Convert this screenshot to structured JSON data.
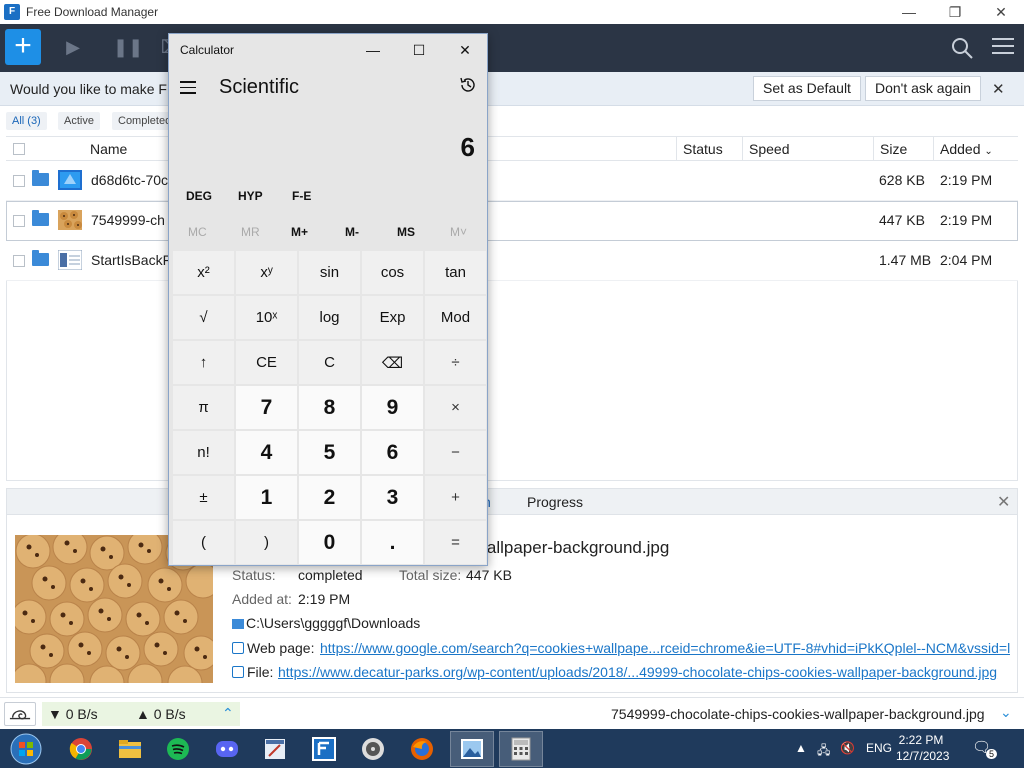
{
  "window": {
    "title": "Free Download Manager",
    "app_icon": "fdm-logo-icon",
    "controls": [
      "minimize",
      "restore",
      "close"
    ]
  },
  "toolbar": {
    "add_label": "+",
    "icons": [
      "add-download-icon",
      "resume-icon",
      "pause-icon",
      "search-icon",
      "menu-icon"
    ]
  },
  "notification": {
    "message": "Would you like to make FD",
    "set_default": "Set as Default",
    "dont_ask": "Don't ask again"
  },
  "filters": [
    {
      "label": "All (3)"
    },
    {
      "label": "Active"
    },
    {
      "label": "Completed"
    }
  ],
  "table": {
    "columns": {
      "name": "Name",
      "status": "Status",
      "speed": "Speed",
      "size": "Size",
      "added": "Added"
    },
    "rows": [
      {
        "name": "d68d6tc-70c",
        "size": "628 KB",
        "added": "2:19 PM"
      },
      {
        "name": "7549999-ch",
        "size": "447 KB",
        "added": "2:19 PM"
      },
      {
        "name": "StartIsBackF",
        "size": "1.47 MB",
        "added": "2:04 PM"
      }
    ]
  },
  "details": {
    "tab_visible": "n",
    "tab_progress": "Progress",
    "filename": "es-wallpaper-background.jpg",
    "status_label": "Status:",
    "status_value": "completed",
    "total_size_label": "Total size:",
    "total_size_value": "447 KB",
    "added_label": "Added at:",
    "added_value": "2:19 PM",
    "folder": "C:\\Users\\gggggf\\Downloads",
    "webpage_label": "Web page:",
    "webpage_url": "https://www.google.com/search?q=cookies+wallpape...rceid=chrome&ie=UTF-8#vhid=iPkKQplel--NCM&vssid=l",
    "file_label": "File:",
    "file_url": "https://www.decatur-parks.org/wp-content/uploads/2018/...49999-chocolate-chips-cookies-wallpaper-background.jpg"
  },
  "statusbar": {
    "down_speed": "▼ 0 B/s",
    "up_speed": "▲ 0 B/s",
    "last_file": "7549999-chocolate-chips-cookies-wallpaper-background.jpg"
  },
  "calculator": {
    "title": "Calculator",
    "mode": "Scientific",
    "display": "6",
    "angle": [
      "DEG",
      "HYP",
      "F-E"
    ],
    "memory": [
      "MC",
      "MR",
      "M+",
      "M-",
      "MS",
      "M˅"
    ],
    "keys": [
      [
        "x²",
        "xʸ",
        "sin",
        "cos",
        "tan"
      ],
      [
        "√",
        "10ˣ",
        "log",
        "Exp",
        "Mod"
      ],
      [
        "↑",
        "CE",
        "C",
        "⌫",
        "÷"
      ],
      [
        "π",
        "7",
        "8",
        "9",
        "×"
      ],
      [
        "n!",
        "4",
        "5",
        "6",
        "−"
      ],
      [
        "±",
        "1",
        "2",
        "3",
        "+"
      ],
      [
        "(",
        ")",
        "0",
        ".",
        "="
      ]
    ]
  },
  "taskbar": {
    "apps": [
      "chrome-icon",
      "file-explorer-icon",
      "spotify-icon",
      "discord-icon",
      "paint-icon",
      "fdm-icon",
      "media-player-icon",
      "firefox-icon",
      "photos-icon",
      "calculator-icon"
    ],
    "language": "ENG",
    "time": "2:22 PM",
    "date": "12/7/2023",
    "notification_count": "5"
  }
}
